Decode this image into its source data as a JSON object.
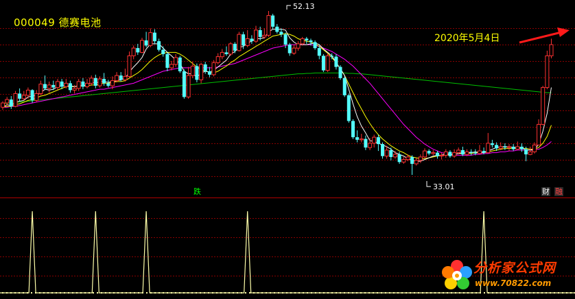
{
  "title": "000049 德赛电池",
  "annotation": "2020年5月4日",
  "peak_label": "52.13",
  "low_label": "33.01",
  "markers": {
    "die": "跌",
    "cai": "财",
    "rong": "融"
  },
  "watermark": {
    "title": "分析家公式网",
    "url": "www.70822.com"
  },
  "colors": {
    "background": "#000000",
    "up": "#ff3232",
    "down": "#54ffff",
    "ma_short": "#ffffff",
    "ma_mid": "#ffff00",
    "ma_long": "#ff00ff",
    "ma_very_long": "#00c000",
    "grid": "#8b0000",
    "signal": "#ffffaa"
  },
  "chart_data": {
    "type": "candlestick",
    "ylim": [
      33.01,
      52.13
    ],
    "peak_price": 52.13,
    "low_price": 33.01,
    "candles": [
      [
        40.9,
        41.4,
        41.6,
        40.6
      ],
      [
        41.4,
        41.8,
        42.1,
        41.1
      ],
      [
        41.8,
        41.0,
        42.2,
        40.7
      ],
      [
        41.0,
        42.5,
        42.8,
        40.9
      ],
      [
        42.5,
        41.9,
        43.1,
        41.6
      ],
      [
        41.9,
        42.3,
        42.8,
        41.7
      ],
      [
        42.3,
        42.9,
        43.2,
        41.9
      ],
      [
        42.9,
        41.7,
        43.0,
        41.4
      ],
      [
        41.7,
        42.5,
        42.9,
        41.5
      ],
      [
        42.5,
        43.6,
        44.0,
        42.3
      ],
      [
        43.6,
        43.1,
        44.6,
        42.9
      ],
      [
        43.1,
        43.5,
        43.9,
        42.6
      ],
      [
        43.5,
        43.2,
        44.0,
        42.9
      ],
      [
        43.2,
        43.9,
        44.2,
        42.9
      ],
      [
        43.9,
        43.3,
        44.2,
        43.0
      ],
      [
        43.3,
        43.7,
        44.2,
        43.1
      ],
      [
        43.7,
        42.9,
        44.0,
        42.6
      ],
      [
        42.9,
        43.1,
        43.5,
        42.5
      ],
      [
        43.1,
        43.9,
        44.2,
        42.8
      ],
      [
        43.9,
        43.3,
        44.3,
        43.0
      ],
      [
        43.3,
        43.7,
        44.2,
        43.1
      ],
      [
        43.7,
        44.3,
        44.6,
        43.4
      ],
      [
        44.3,
        43.4,
        44.7,
        43.1
      ],
      [
        43.4,
        44.2,
        44.5,
        43.2
      ],
      [
        44.2,
        43.7,
        44.9,
        43.4
      ],
      [
        43.7,
        43.4,
        44.1,
        43.2
      ],
      [
        43.4,
        44.0,
        44.5,
        43.0
      ],
      [
        44.0,
        44.6,
        45.0,
        43.8
      ],
      [
        44.6,
        44.1,
        45.0,
        43.9
      ],
      [
        44.1,
        44.5,
        45.4,
        43.9
      ],
      [
        44.5,
        46.9,
        47.4,
        44.3
      ],
      [
        46.9,
        47.8,
        48.1,
        46.5
      ],
      [
        47.8,
        47.3,
        48.3,
        47.0
      ],
      [
        47.3,
        48.7,
        49.0,
        47.2
      ],
      [
        48.7,
        48.1,
        49.7,
        47.9
      ],
      [
        48.1,
        49.6,
        50.1,
        47.9
      ],
      [
        49.6,
        48.6,
        50.0,
        48.3
      ],
      [
        48.6,
        47.6,
        48.9,
        47.4
      ],
      [
        47.6,
        47.1,
        48.0,
        46.8
      ],
      [
        47.1,
        45.5,
        47.3,
        45.1
      ],
      [
        45.5,
        45.9,
        46.3,
        45.2
      ],
      [
        45.9,
        46.7,
        47.1,
        45.6
      ],
      [
        46.7,
        45.1,
        46.9,
        44.9
      ],
      [
        45.1,
        42.1,
        45.3,
        41.9
      ],
      [
        42.1,
        44.6,
        45.6,
        41.9
      ],
      [
        44.6,
        45.7,
        46.2,
        44.3
      ],
      [
        45.7,
        44.1,
        46.0,
        43.8
      ],
      [
        44.1,
        45.9,
        46.1,
        43.7
      ],
      [
        45.9,
        45.1,
        46.2,
        44.8
      ],
      [
        45.1,
        44.7,
        45.6,
        44.4
      ],
      [
        44.7,
        46.1,
        46.4,
        44.5
      ],
      [
        46.1,
        46.8,
        47.2,
        45.9
      ],
      [
        46.8,
        47.3,
        47.7,
        46.5
      ],
      [
        47.3,
        47.1,
        48.0,
        46.9
      ],
      [
        47.1,
        48.3,
        48.5,
        46.9
      ],
      [
        48.3,
        47.5,
        48.5,
        47.2
      ],
      [
        47.5,
        49.4,
        49.7,
        47.4
      ],
      [
        49.4,
        48.1,
        49.7,
        47.7
      ],
      [
        48.1,
        48.9,
        49.9,
        47.9
      ],
      [
        48.9,
        48.6,
        49.3,
        48.3
      ],
      [
        48.6,
        49.9,
        50.4,
        48.4
      ],
      [
        49.9,
        49.1,
        50.3,
        48.7
      ],
      [
        49.1,
        49.3,
        50.1,
        48.9
      ],
      [
        49.3,
        51.6,
        52.13,
        49.1
      ],
      [
        51.6,
        50.3,
        51.8,
        50.0
      ],
      [
        50.3,
        49.7,
        50.6,
        49.5
      ],
      [
        49.7,
        49.4,
        50.1,
        49.1
      ],
      [
        49.4,
        48.2,
        49.6,
        47.8
      ],
      [
        48.2,
        47.2,
        48.4,
        46.9
      ],
      [
        47.2,
        47.8,
        48.2,
        47.0
      ],
      [
        47.8,
        48.3,
        48.6,
        47.5
      ],
      [
        48.3,
        48.9,
        49.1,
        48.1
      ],
      [
        48.9,
        48.7,
        49.1,
        48.3
      ],
      [
        48.7,
        48.5,
        48.9,
        48.1
      ],
      [
        48.5,
        47.8,
        48.7,
        47.6
      ],
      [
        47.8,
        46.9,
        48.1,
        46.5
      ],
      [
        46.9,
        45.2,
        47.1,
        45.0
      ],
      [
        45.2,
        46.9,
        47.2,
        45.0
      ],
      [
        46.9,
        46.8,
        47.2,
        46.5
      ],
      [
        46.8,
        45.6,
        47.1,
        45.3
      ],
      [
        45.6,
        44.3,
        45.8,
        44.1
      ],
      [
        44.3,
        42.3,
        44.5,
        42.1
      ],
      [
        42.3,
        39.3,
        42.5,
        39.1
      ],
      [
        39.3,
        37.4,
        39.5,
        37.2
      ],
      [
        37.4,
        37.1,
        38.2,
        36.8
      ],
      [
        37.1,
        37.2,
        37.8,
        36.8
      ],
      [
        37.2,
        36.2,
        37.6,
        35.9
      ],
      [
        36.2,
        36.7,
        37.3,
        35.9
      ],
      [
        36.7,
        37.4,
        37.7,
        36.2
      ],
      [
        37.4,
        36.6,
        37.7,
        35.8
      ],
      [
        36.6,
        35.2,
        36.8,
        34.9
      ],
      [
        35.2,
        35.9,
        36.4,
        34.9
      ],
      [
        35.9,
        35.1,
        36.2,
        34.7
      ],
      [
        35.1,
        35.4,
        35.8,
        34.9
      ],
      [
        35.4,
        34.5,
        35.7,
        34.3
      ],
      [
        34.5,
        34.8,
        35.1,
        34.3
      ],
      [
        34.8,
        35.1,
        35.4,
        34.6
      ],
      [
        35.1,
        34.3,
        35.3,
        33.01
      ],
      [
        34.3,
        34.7,
        35.0,
        34.1
      ],
      [
        34.7,
        35.1,
        35.4,
        34.4
      ],
      [
        35.1,
        35.8,
        36.1,
        34.9
      ],
      [
        35.8,
        35.5,
        36.0,
        35.3
      ],
      [
        35.5,
        35.6,
        35.9,
        35.3
      ],
      [
        35.6,
        35.2,
        35.8,
        34.9
      ],
      [
        35.2,
        35.3,
        35.6,
        34.8
      ],
      [
        35.3,
        35.7,
        36.0,
        35.0
      ],
      [
        35.7,
        35.2,
        35.9,
        35.0
      ],
      [
        35.2,
        35.6,
        36.0,
        35.0
      ],
      [
        35.6,
        35.9,
        36.2,
        35.4
      ],
      [
        35.9,
        35.4,
        36.3,
        35.2
      ],
      [
        35.4,
        35.7,
        36.0,
        35.2
      ],
      [
        35.7,
        35.6,
        36.0,
        35.3
      ],
      [
        35.6,
        35.5,
        36.0,
        35.3
      ],
      [
        35.5,
        35.8,
        36.5,
        35.4
      ],
      [
        35.8,
        35.6,
        36.2,
        35.4
      ],
      [
        35.6,
        36.7,
        37.9,
        35.7
      ],
      [
        36.7,
        36.5,
        37.1,
        36.2
      ],
      [
        36.5,
        36.1,
        36.8,
        35.8
      ],
      [
        36.1,
        36.3,
        36.8,
        35.9
      ],
      [
        36.3,
        36.2,
        36.7,
        35.9
      ],
      [
        36.2,
        36.3,
        36.6,
        35.8
      ],
      [
        36.3,
        36.0,
        36.6,
        35.8
      ],
      [
        36.0,
        36.3,
        36.9,
        35.9
      ],
      [
        36.3,
        36.0,
        36.7,
        35.7
      ],
      [
        36.0,
        35.4,
        36.3,
        34.6
      ],
      [
        35.4,
        35.7,
        36.3,
        35.3
      ],
      [
        35.7,
        36.5,
        36.8,
        35.5
      ],
      [
        36.5,
        38.9,
        39.5,
        36.5
      ],
      [
        38.9,
        43.2,
        43.4,
        38.8
      ],
      [
        43.2,
        46.9,
        47.5,
        43.0
      ],
      [
        46.9,
        48.2,
        48.9,
        46.6
      ]
    ],
    "ma_short_values": [
      40.9,
      41.2,
      41.1,
      41.5,
      41.6,
      41.7,
      42.1,
      42.2,
      42.3,
      42.6,
      43.0,
      42.9,
      43.0,
      43.3,
      43.4,
      43.4,
      43.4,
      43.3,
      43.4,
      43.4,
      43.5,
      43.8,
      43.7,
      43.9,
      43.9,
      43.8,
      43.9,
      44.0,
      44.1,
      44.3,
      45.0,
      45.6,
      46.1,
      46.7,
      47.7,
      48.3,
      48.3,
      48.3,
      47.8,
      47.3,
      46.9,
      46.4,
      46.0,
      45.1,
      44.8,
      44.8,
      44.4,
      44.9,
      45.1,
      45.0,
      45.2,
      45.6,
      46.0,
      46.4,
      47.1,
      47.4,
      47.9,
      48.0,
      48.4,
      48.6,
      48.9,
      48.9,
      49.0,
      49.7,
      50.0,
      50.0,
      50.0,
      49.9,
      49.0,
      48.5,
      48.2,
      48.2,
      48.2,
      48.3,
      48.4,
      48.2,
      47.7,
      47.3,
      46.9,
      46.1,
      45.4,
      44.6,
      43.0,
      41.3,
      39.8,
      38.7,
      37.9,
      37.0,
      36.9,
      36.7,
      36.5,
      36.3,
      36.0,
      35.6,
      35.4,
      35.2,
      34.9,
      34.7,
      34.6,
      34.6,
      34.8,
      35.0,
      35.2,
      35.3,
      35.3,
      35.5,
      35.4,
      35.4,
      35.5,
      35.6,
      35.6,
      35.6,
      35.7,
      35.6,
      35.6,
      35.8,
      36.0,
      36.2,
      36.3,
      36.3,
      36.3,
      36.2,
      36.2,
      36.2,
      35.9,
      35.9,
      35.9,
      36.6,
      38.1,
      40.2,
      43.2
    ],
    "ma_mid_values": [
      40.9,
      41.0,
      41.0,
      41.2,
      41.3,
      41.5,
      41.7,
      41.8,
      42.0,
      42.2,
      42.3,
      42.5,
      42.7,
      42.9,
      43.1,
      43.3,
      43.3,
      43.3,
      43.4,
      43.4,
      43.4,
      43.5,
      43.5,
      43.6,
      43.7,
      43.7,
      43.8,
      43.9,
      43.9,
      44.0,
      44.3,
      44.6,
      44.9,
      45.3,
      45.8,
      46.3,
      46.7,
      47.0,
      47.2,
      47.3,
      47.3,
      47.3,
      47.1,
      46.8,
      46.4,
      46.0,
      45.6,
      45.3,
      45.1,
      45.0,
      44.9,
      45.1,
      45.4,
      45.7,
      46.1,
      46.4,
      46.8,
      47.1,
      47.4,
      47.7,
      48.0,
      48.3,
      48.6,
      48.9,
      49.2,
      49.3,
      49.4,
      49.5,
      49.4,
      49.2,
      48.9,
      48.7,
      48.6,
      48.5,
      48.3,
      48.0,
      47.6,
      47.2,
      46.7,
      46.1,
      45.4,
      44.6,
      43.6,
      42.6,
      41.6,
      40.7,
      39.8,
      39.0,
      38.3,
      37.7,
      37.2,
      36.8,
      36.4,
      36.1,
      35.8,
      35.6,
      35.3,
      35.1,
      35.0,
      34.9,
      34.9,
      35.0,
      35.1,
      35.2,
      35.3,
      35.3,
      35.4,
      35.4,
      35.5,
      35.5,
      35.5,
      35.5,
      35.6,
      35.6,
      35.6,
      35.7,
      35.8,
      35.9,
      36.0,
      36.1,
      36.1,
      36.1,
      36.1,
      36.1,
      36.1,
      36.0,
      36.0,
      36.2,
      36.7,
      37.5,
      38.8
    ],
    "ma_long_values": [
      40.9,
      40.9,
      41.0,
      41.0,
      41.1,
      41.2,
      41.3,
      41.4,
      41.5,
      41.6,
      41.7,
      41.8,
      41.9,
      42.0,
      42.1,
      42.2,
      42.3,
      42.4,
      42.5,
      42.6,
      42.7,
      42.8,
      42.9,
      43.0,
      43.0,
      43.1,
      43.2,
      43.3,
      43.4,
      43.5,
      43.6,
      43.7,
      43.9,
      44.1,
      44.3,
      44.5,
      44.7,
      44.9,
      45.1,
      45.2,
      45.3,
      45.4,
      45.5,
      45.5,
      45.5,
      45.5,
      45.5,
      45.5,
      45.5,
      45.5,
      45.5,
      45.6,
      45.7,
      45.8,
      45.9,
      46.0,
      46.2,
      46.4,
      46.6,
      46.8,
      47.0,
      47.2,
      47.4,
      47.6,
      47.8,
      47.9,
      48.0,
      48.1,
      48.2,
      48.2,
      48.2,
      48.2,
      48.2,
      48.2,
      48.1,
      48.0,
      47.8,
      47.6,
      47.4,
      47.1,
      46.8,
      46.5,
      46.1,
      45.7,
      45.2,
      44.7,
      44.2,
      43.7,
      43.1,
      42.5,
      41.9,
      41.3,
      40.7,
      40.1,
      39.5,
      38.9,
      38.4,
      37.9,
      37.4,
      37.0,
      36.6,
      36.3,
      36.0,
      35.8,
      35.6,
      35.5,
      35.4,
      35.3,
      35.3,
      35.3,
      35.3,
      35.3,
      35.4,
      35.4,
      35.5,
      35.5,
      35.6,
      35.6,
      35.7,
      35.7,
      35.8,
      35.8,
      35.9,
      35.9,
      35.9,
      35.9,
      36.0,
      36.0,
      36.2,
      36.5,
      36.9
    ],
    "ma_very_long_values": [
      41.3,
      41.35,
      41.4,
      41.45,
      41.5,
      41.55,
      41.6,
      41.65,
      41.7,
      41.75,
      41.8,
      41.85,
      41.9,
      41.95,
      42.0,
      42.05,
      42.1,
      42.15,
      42.2,
      42.25,
      42.3,
      42.35,
      42.4,
      42.45,
      42.5,
      42.55,
      42.6,
      42.65,
      42.7,
      42.75,
      42.8,
      42.85,
      42.9,
      42.95,
      43.0,
      43.05,
      43.1,
      43.15,
      43.2,
      43.25,
      43.3,
      43.35,
      43.4,
      43.45,
      43.5,
      43.55,
      43.6,
      43.65,
      43.7,
      43.75,
      43.8,
      43.85,
      43.9,
      43.95,
      44.0,
      44.05,
      44.1,
      44.15,
      44.2,
      44.25,
      44.3,
      44.35,
      44.4,
      44.45,
      44.5,
      44.55,
      44.6,
      44.65,
      44.7,
      44.75,
      44.8,
      44.8,
      44.85,
      44.85,
      44.9,
      44.9,
      44.9,
      44.9,
      44.9,
      44.9,
      44.9,
      44.9,
      44.85,
      44.85,
      44.8,
      44.8,
      44.75,
      44.7,
      44.65,
      44.6,
      44.55,
      44.5,
      44.45,
      44.4,
      44.35,
      44.3,
      44.25,
      44.2,
      44.15,
      44.1,
      44.05,
      44.0,
      43.95,
      43.9,
      43.85,
      43.8,
      43.75,
      43.7,
      43.65,
      43.6,
      43.55,
      43.5,
      43.45,
      43.4,
      43.35,
      43.3,
      43.25,
      43.2,
      43.15,
      43.1,
      43.05,
      43.0,
      42.95,
      42.9,
      42.85,
      42.8,
      42.75,
      42.7,
      42.65,
      42.6,
      42.6
    ],
    "signal_spikes": [
      7,
      22,
      34,
      58,
      114
    ]
  }
}
